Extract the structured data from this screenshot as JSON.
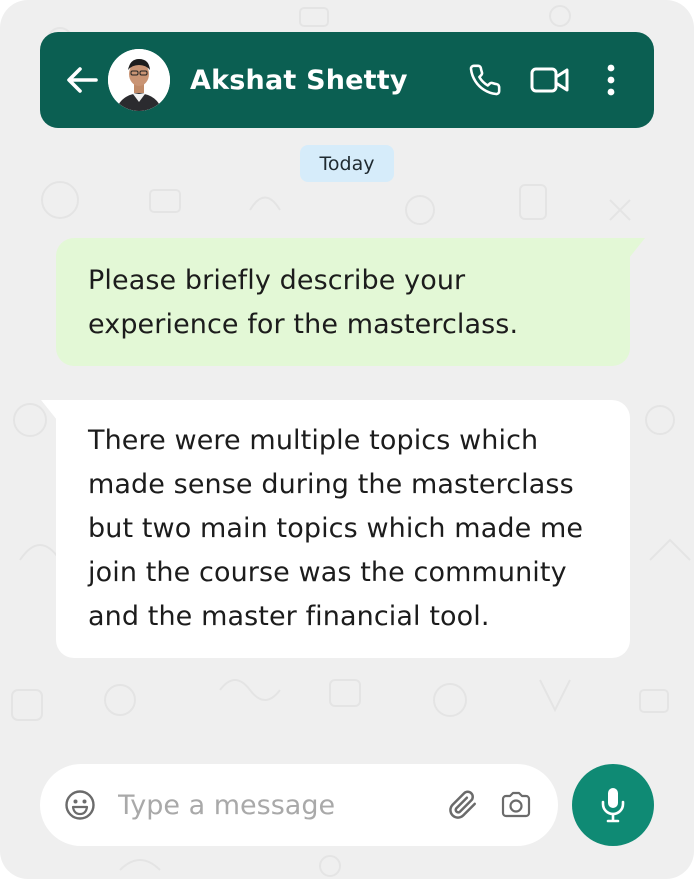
{
  "header": {
    "contact_name": "Akshat Shetty",
    "back_icon": "arrow-left-icon",
    "call_icon": "phone-icon",
    "video_icon": "video-camera-icon",
    "menu_icon": "more-vertical-icon"
  },
  "chat": {
    "date_label": "Today",
    "messages": [
      {
        "direction": "outgoing",
        "text": "Please briefly describe your experience for the masterclass."
      },
      {
        "direction": "incoming",
        "text": "There were multiple topics which made sense during the masterclass but two main topics which made me join the course was the community and the master financial tool."
      }
    ]
  },
  "composer": {
    "placeholder": "Type a message",
    "value": "",
    "emoji_icon": "emoji-icon",
    "attach_icon": "paperclip-icon",
    "camera_icon": "camera-icon",
    "mic_icon": "microphone-icon"
  },
  "colors": {
    "header_bg": "#0b5f52",
    "outgoing_bubble": "#e3f8d6",
    "incoming_bubble": "#ffffff",
    "date_chip": "#d6ecfa",
    "mic_button": "#0f8a74",
    "chat_bg": "#efefef"
  }
}
